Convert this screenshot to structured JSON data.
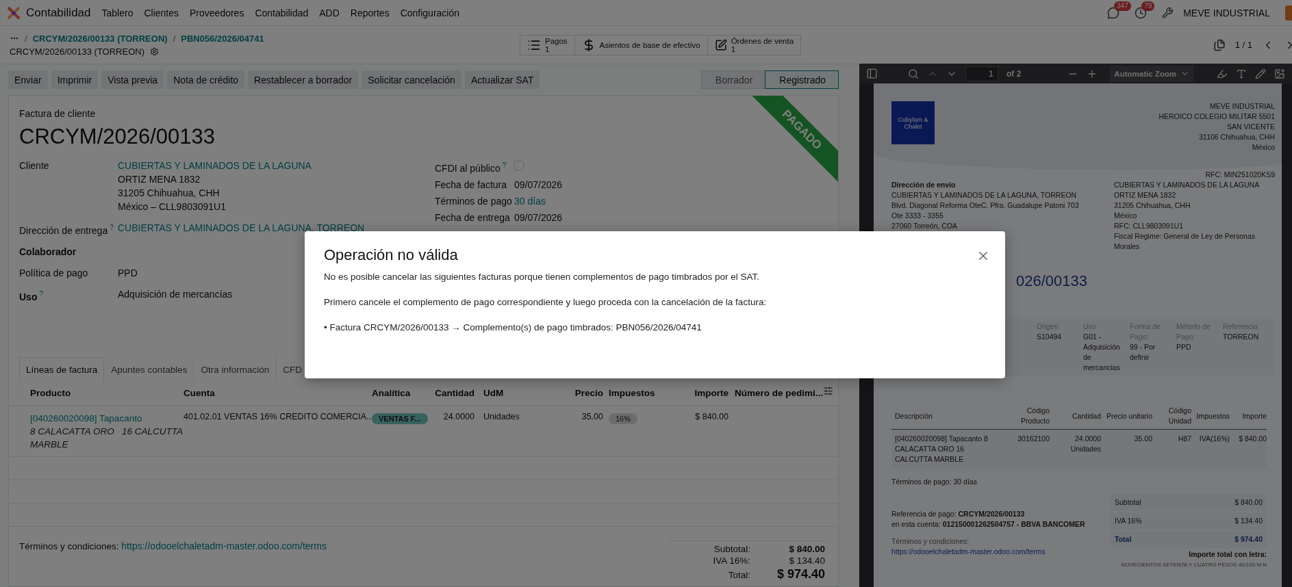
{
  "nav": {
    "app": "Contabilidad",
    "menu": [
      "Tablero",
      "Clientes",
      "Proveedores",
      "Contabilidad",
      "ADD",
      "Reportes",
      "Configuración"
    ],
    "messages_badge": "347",
    "activities_badge": "79",
    "company": "MEVE INDUSTRIAL"
  },
  "breadcrumb": {
    "separator": "/",
    "items": [
      "CRCYM/2026/00133 (TORREON)",
      "PBN056/2026/04741"
    ],
    "current": "CRCYM/2026/00133 (TORREON)"
  },
  "smart_buttons": [
    {
      "kind": "list",
      "label": "Pagos",
      "count": "1"
    },
    {
      "kind": "dollar",
      "label": "Asientos de base de efectivo"
    },
    {
      "kind": "edit",
      "label": "Órdenes de venta",
      "count": "1"
    }
  ],
  "pager": "1 / 1",
  "actions": [
    "Enviar",
    "Imprimir",
    "Vista previa",
    "Nota de crédito",
    "Restablecer a borrador",
    "Solicitar cancelación",
    "Actualizar SAT"
  ],
  "status": [
    {
      "label": "Borrador",
      "selected": false
    },
    {
      "label": "Registrado",
      "selected": true
    }
  ],
  "ribbon": "PAGADO",
  "form": {
    "subtitle": "Factura de cliente",
    "title": "CRCYM/2026/00133",
    "left_fields": [
      {
        "label": "Cliente",
        "kind": "address",
        "value": "CUBIERTAS Y LAMINADOS DE LA LAGUNA",
        "lines": [
          "ORTIZ MENA 1832",
          "31205 Chihuahua, CHH",
          "México – CLL9803091U1"
        ]
      },
      {
        "label": "Dirección de entrega",
        "help": "?",
        "kind": "link",
        "value": "CUBIERTAS Y LAMINADOS DE LA LAGUNA, TORREON"
      },
      {
        "label": "Colaborador",
        "bold": true,
        "kind": "empty"
      },
      {
        "label": "Política de pago",
        "kind": "text",
        "value": "PPD"
      },
      {
        "label": "Uso",
        "help": "?",
        "bold": true,
        "kind": "text",
        "value": "Adquisición de mercancías"
      }
    ],
    "right_fields": [
      {
        "label": "CFDI al público",
        "help": "?",
        "kind": "checkbox",
        "checked": false
      },
      {
        "label": "Fecha de factura",
        "kind": "text",
        "value": "09/07/2026"
      },
      {
        "label": "Términos de pago",
        "kind": "link",
        "value": "30 días"
      },
      {
        "label": "Fecha de entrega",
        "kind": "text",
        "value": "09/07/2026"
      }
    ]
  },
  "tabs": [
    {
      "label": "Líneas de factura",
      "selected": true
    },
    {
      "label": "Apuntes contables",
      "selected": false
    },
    {
      "label": "Otra información",
      "selected": false
    },
    {
      "label": "CFD",
      "selected": false
    }
  ],
  "lines": {
    "columns": [
      "Producto",
      "Cuenta",
      "Analítica",
      "Cantidad",
      "UdM",
      "Precio",
      "Impuestos",
      "Importe",
      "Número de pedimi..."
    ],
    "rows": [
      {
        "product": "[040260020098] Tapacanto",
        "description": "8 CALACATTA ORO   16 CALCUTTA MARBLE",
        "account": "401.02.01 VENTAS 16% CREDITO COMERCIA...",
        "analytic": "VENTAS F...",
        "quantity": "24.0000",
        "uom": "Unidades",
        "price": "35.00",
        "tax": "16%",
        "amount": "$ 840.00"
      }
    ]
  },
  "terms": {
    "label": "Términos y condiciones:",
    "link": "https://odooelchaletadm-master.odoo.com/terms"
  },
  "totals": [
    {
      "label": "Subtotal:",
      "value": "$ 840.00",
      "kind": "bold"
    },
    {
      "label": "IVA 16%:",
      "value": "$ 134.40",
      "kind": "normal"
    },
    {
      "label": "Total:",
      "value": "$ 974.40",
      "kind": "grand"
    }
  ],
  "pdf": {
    "page": "1",
    "page_count": "of 2",
    "zoom": "Automatic Zoom",
    "logo_text": "Cubylam & Chalet",
    "company": [
      "MEVE INDUSTRIAL",
      "HEROICO COLEGIO MILITAR 5501",
      "SAN VICENTE",
      "31106 Chihuahua, CHH",
      "México"
    ],
    "rfc": "RFC: MIN251020KS9",
    "shipping_title": "Dirección de envío",
    "shipping": [
      "CUBIERTAS Y LAMINADOS DE LA LAGUNA, TORREON",
      "Blvd. Diagonal Reforma OteC. Pfra. Guadalupe Patoni 703",
      "Ote 3333 - 3355",
      "27060 Torreón, COA"
    ],
    "customer": [
      "CUBIERTAS Y LAMINADOS DE LA LAGUNA",
      "ORTIZ MENA 1832",
      "31205 Chihuahua, CHH",
      "México",
      "RFC: CLL9803091U1",
      "Fiscal Regime: General de Ley de Personas Morales"
    ],
    "title": "026/00133",
    "info": [
      {
        "label": "Origen",
        "value": "S10494"
      },
      {
        "label": "Uso",
        "value": "G01 - Adquisición de mercancias"
      },
      {
        "label": "Forma de Pago:",
        "value": "99 - Por definir"
      },
      {
        "label": "Método de Pago:",
        "value": "PPD"
      },
      {
        "label": "Referencia",
        "value": "TORREON"
      }
    ],
    "columns": [
      "Descripción",
      "Código Producto",
      "Cantidad",
      "Precio unitario",
      "Código Unidad",
      "Impuestos",
      "Importe"
    ],
    "rows": [
      {
        "cells": [
          "[040260020098] Tapacanto 8 CALACATTA ORO 16 CALCUTTA MARBLE",
          "30162100",
          "24.0000 Unidades",
          "35.00",
          "H87",
          "IVA(16%)",
          "$ 840.00"
        ]
      }
    ],
    "payment_terms": "Términos de pago: 30 días",
    "payment_reference": [
      "Referencia de pago: **CRCYM/2026/00133**",
      "en esta cuenta: **012150001262504757 - BBVA BANCOMER**"
    ],
    "terms_label": "Términos y condiciones:",
    "terms_link": "https://odooelchaletadm-master.odoo.com/terms",
    "totals": [
      {
        "label": "Subtotal",
        "value": "$ 840.00",
        "kind": "normal"
      },
      {
        "label": "IVA 16%",
        "value": "$ 134.40",
        "kind": "normal"
      },
      {
        "label": "Total",
        "value": "$ 974.40",
        "kind": "grand"
      }
    ],
    "amount_words_label": "Importe total con letra:",
    "amount_words": "NOVECIENTOS SETENTA Y CUATRO PESOS 40/100 M.N"
  },
  "modal": {
    "title": "Operación no válida",
    "paragraphs": [
      "No es posible cancelar las siguientes facturas porque tienen complementos de pago timbrados por el SAT.",
      "Primero cancele el complemento de pago correspondiente y luego proceda con la cancelación de la factura:",
      "• Factura CRCYM/2026/00133  →  Complemento(s) de pago timbrados: PBN056/2026/04741"
    ]
  }
}
